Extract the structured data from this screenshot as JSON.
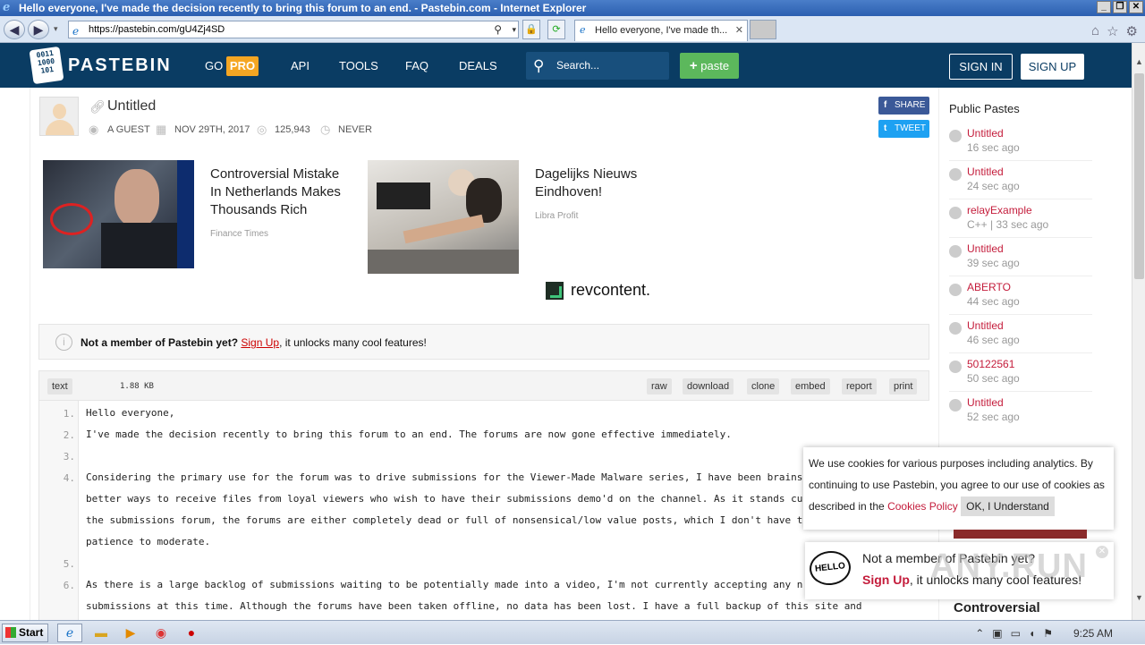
{
  "window": {
    "title": "Hello everyone, I've made the decision recently to bring this forum to an end. - Pastebin.com - Internet Explorer",
    "url": "https://pastebin.com/gU4Zj4SD",
    "tab_title": "Hello everyone, I've made th..."
  },
  "header": {
    "logo_glyph": "0011\n1000\n101",
    "logo_text": "PASTEBIN",
    "go_label": "GO",
    "pro_label": "PRO",
    "nav": [
      "API",
      "TOOLS",
      "FAQ",
      "DEALS"
    ],
    "search_placeholder": "Search...",
    "paste_label": "paste",
    "signin_label": "SIGN IN",
    "signup_label": "SIGN UP",
    "accent_color": "#0a3c63"
  },
  "paste": {
    "title": "Untitled",
    "author": "A GUEST",
    "date": "NOV 29TH, 2017",
    "views": "125,943",
    "expires": "NEVER",
    "share_label": "SHARE",
    "tweet_label": "TWEET",
    "syntax": "text",
    "size": "1.88 KB",
    "actions": [
      "raw",
      "download",
      "clone",
      "embed",
      "report",
      "print"
    ]
  },
  "ads": [
    {
      "title_lines": [
        "Controversial Mistake",
        "In Netherlands Makes",
        "Thousands Rich"
      ],
      "source": "Finance Times"
    },
    {
      "title_lines": [
        "Dagelijks Nieuws",
        "Eindhoven!"
      ],
      "source": "Libra Profit"
    }
  ],
  "revcontent_label": "revcontent.",
  "member_notice": {
    "prefix": "Not a member of Pastebin yet? ",
    "link": "Sign Up",
    "suffix": ", it unlocks many cool features!"
  },
  "code_lines": [
    {
      "num": "1.",
      "text": "Hello everyone,"
    },
    {
      "num": "2.",
      "text": "I've made the decision recently to bring this forum to an end. The forums are now gone effective immediately."
    },
    {
      "num": "3.",
      "text": ""
    },
    {
      "num": "4.",
      "text": "Considering the primary use for the forum was to drive submissions for the Viewer-Made Malware series, I have been brains"
    },
    {
      "num": "",
      "text": "better ways to receive files from loyal viewers who wish to have their submissions demo'd on the channel. As it stands cu"
    },
    {
      "num": "",
      "text": "the submissions forum, the forums are either completely dead or full of nonsensical/low value posts, which I don't have t"
    },
    {
      "num": "",
      "text": "patience to moderate."
    },
    {
      "num": "5.",
      "text": ""
    },
    {
      "num": "6.",
      "text": "As there is a large backlog of submissions waiting to be potentially made into a video, I'm not currently accepting any n"
    },
    {
      "num": "",
      "text": "submissions at this time. Although the forums have been taken offline, no data has been lost. I have a full backup of this site and"
    }
  ],
  "sidebar": {
    "title": "Public Pastes",
    "items": [
      {
        "name": "Untitled",
        "time": "16 sec ago"
      },
      {
        "name": "Untitled",
        "time": "24 sec ago"
      },
      {
        "name": "relayExample",
        "time": "C++ | 33 sec ago"
      },
      {
        "name": "Untitled",
        "time": "39 sec ago"
      },
      {
        "name": "ABERTO",
        "time": "44 sec ago"
      },
      {
        "name": "Untitled",
        "time": "46 sec ago"
      },
      {
        "name": "50122561",
        "time": "50 sec ago"
      },
      {
        "name": "Untitled",
        "time": "52 sec ago"
      }
    ]
  },
  "cookie": {
    "text": "We use cookies for various purposes including analytics. By continuing to use Pastebin, you agree to our use of cookies as described in the ",
    "link": "Cookies Policy",
    "ok": "OK, I Understand"
  },
  "popup": {
    "hello": "HELLO",
    "title": "Not a member of Pastebin yet?",
    "link": "Sign Up",
    "suffix": ", it unlocks many cool features!"
  },
  "watermark": "ANY.RUN",
  "side_ad_title": "Controversial",
  "taskbar": {
    "start": "Start",
    "clock": "9:25 AM"
  }
}
